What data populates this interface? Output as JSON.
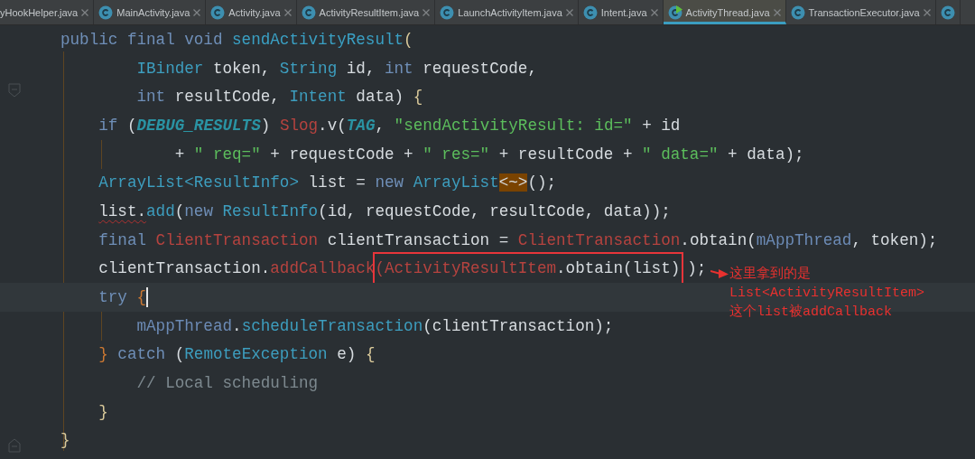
{
  "tabs": [
    {
      "label": "yHookHelper.java",
      "kind": "plain",
      "selected": false
    },
    {
      "label": "MainActivity.java",
      "kind": "class",
      "selected": false
    },
    {
      "label": "Activity.java",
      "kind": "class",
      "selected": false
    },
    {
      "label": "ActivityResultItem.java",
      "kind": "class",
      "selected": false
    },
    {
      "label": "LaunchActivityItem.java",
      "kind": "class",
      "selected": false
    },
    {
      "label": "Intent.java",
      "kind": "class",
      "selected": false
    },
    {
      "label": "ActivityThread.java",
      "kind": "class_run",
      "selected": true
    },
    {
      "label": "TransactionExecutor.java",
      "kind": "class",
      "selected": false
    },
    {
      "kind": "class",
      "selected": false
    }
  ],
  "code": [
    {
      "current": false,
      "tokens": [
        {
          "kind": "kw",
          "text": "public final void "
        },
        {
          "kind": "decl",
          "text": "sendActivityResult"
        },
        {
          "kind": "brace",
          "text": "("
        }
      ]
    },
    {
      "current": false,
      "tokens": [
        {
          "kind": "type",
          "text": "        IBinder"
        },
        {
          "kind": "plain",
          "text": " token, "
        },
        {
          "kind": "type",
          "text": "String"
        },
        {
          "kind": "plain",
          "text": " id, "
        },
        {
          "kind": "kw",
          "text": "int"
        },
        {
          "kind": "plain",
          "text": " requestCode,"
        }
      ]
    },
    {
      "current": false,
      "tokens": [
        {
          "kind": "kw",
          "text": "        int"
        },
        {
          "kind": "plain",
          "text": " resultCode, "
        },
        {
          "kind": "type",
          "text": "Intent"
        },
        {
          "kind": "plain",
          "text": " data) "
        },
        {
          "kind": "brace",
          "text": "{"
        }
      ]
    },
    {
      "current": false,
      "tokens": [
        {
          "kind": "kw",
          "text": "    if"
        },
        {
          "kind": "plain",
          "text": " ("
        },
        {
          "kind": "const",
          "text": "DEBUG_RESULTS"
        },
        {
          "kind": "plain",
          "text": ") "
        },
        {
          "kind": "red",
          "text": "Slog"
        },
        {
          "kind": "plain",
          "text": ".v("
        },
        {
          "kind": "const",
          "text": "TAG"
        },
        {
          "kind": "plain",
          "text": ", "
        },
        {
          "kind": "str",
          "text": "\"sendActivityResult: id=\""
        },
        {
          "kind": "plain",
          "text": " + id"
        }
      ]
    },
    {
      "current": false,
      "tokens": [
        {
          "kind": "plain",
          "text": "            + "
        },
        {
          "kind": "str",
          "text": "\" req=\""
        },
        {
          "kind": "plain",
          "text": " + requestCode + "
        },
        {
          "kind": "str",
          "text": "\" res=\""
        },
        {
          "kind": "plain",
          "text": " + resultCode + "
        },
        {
          "kind": "str",
          "text": "\" data=\""
        },
        {
          "kind": "plain",
          "text": " + data);"
        }
      ]
    },
    {
      "current": false,
      "tokens": [
        {
          "kind": "type",
          "text": "    ArrayList<ResultInfo>"
        },
        {
          "kind": "plain",
          "text": " list = "
        },
        {
          "kind": "kw",
          "text": "new"
        },
        {
          "kind": "type",
          "text": " ArrayList"
        },
        {
          "kind": "folded",
          "text": "<~>"
        },
        {
          "kind": "plain",
          "text": "();"
        }
      ]
    },
    {
      "current": false,
      "tokens": [
        {
          "kind": "err",
          "text": "    list."
        },
        {
          "kind": "type",
          "text": "add"
        },
        {
          "kind": "plain",
          "text": "("
        },
        {
          "kind": "kw",
          "text": "new"
        },
        {
          "kind": "type",
          "text": " ResultInfo"
        },
        {
          "kind": "plain",
          "text": "(id, requestCode, resultCode, data));"
        }
      ]
    },
    {
      "current": false,
      "tokens": [
        {
          "kind": "kw",
          "text": "    final"
        },
        {
          "kind": "red",
          "text": " ClientTransaction"
        },
        {
          "kind": "plain",
          "text": " clientTransaction = "
        },
        {
          "kind": "red",
          "text": "ClientTransaction"
        },
        {
          "kind": "plain",
          "text": ".obtain("
        },
        {
          "kind": "field",
          "text": "mAppThread"
        },
        {
          "kind": "plain",
          "text": ", token);"
        }
      ]
    },
    {
      "current": false,
      "tokens": [
        {
          "kind": "plain",
          "text": "    clientTransaction."
        },
        {
          "kind": "red",
          "text": "addCallback"
        },
        {
          "kind": "red",
          "text": "(ActivityResultItem",
          "boxed": true
        },
        {
          "kind": "plain",
          "text": ".obtain(list)",
          "boxed": true
        },
        {
          "kind": "plain",
          "text": ");"
        }
      ],
      "note": [
        "这里拿到的是",
        "List<ActivityResultItem>",
        "这个list被addCallback"
      ]
    },
    {
      "current": true,
      "tokens": [
        {
          "kind": "kw",
          "text": "    try"
        },
        {
          "kind": "obrace",
          "text": " {"
        }
      ]
    },
    {
      "current": false,
      "tokens": [
        {
          "kind": "field",
          "text": "        mAppThread"
        },
        {
          "kind": "plain",
          "text": "."
        },
        {
          "kind": "type",
          "text": "scheduleTransaction"
        },
        {
          "kind": "plain",
          "text": "(clientTransaction);"
        }
      ]
    },
    {
      "current": false,
      "tokens": [
        {
          "kind": "obrace",
          "text": "    }"
        },
        {
          "kind": "kw",
          "text": " catch"
        },
        {
          "kind": "plain",
          "text": " ("
        },
        {
          "kind": "type",
          "text": "RemoteException"
        },
        {
          "kind": "plain",
          "text": " e) "
        },
        {
          "kind": "brace",
          "text": "{"
        }
      ]
    },
    {
      "current": false,
      "tokens": [
        {
          "kind": "comment",
          "text": "        // Local scheduling"
        }
      ]
    },
    {
      "current": false,
      "tokens": [
        {
          "kind": "brace",
          "text": "    }"
        }
      ]
    },
    {
      "current": false,
      "tokens": [
        {
          "kind": "brace",
          "text": "}"
        }
      ]
    }
  ]
}
